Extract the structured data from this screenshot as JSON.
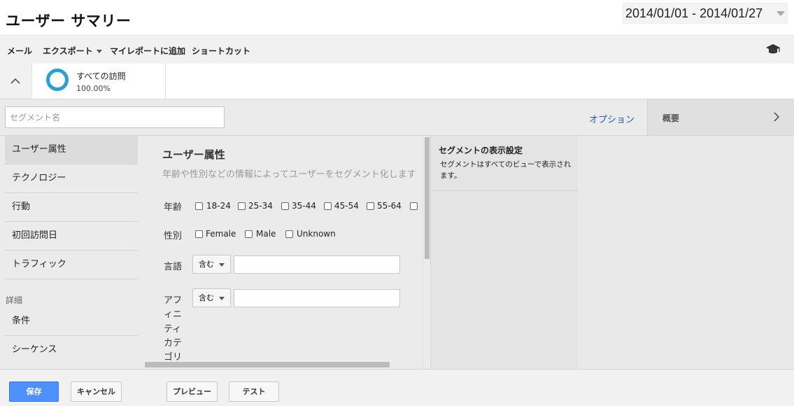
{
  "header": {
    "title": "ユーザー サマリー",
    "date_range": "2014/01/01 - 2014/01/27"
  },
  "toolbar": {
    "mail": "メール",
    "export": "エクスポート",
    "add_to_dashboard": "マイレポートに追加",
    "shortcut": "ショートカット"
  },
  "segment": {
    "name": "すべての訪問",
    "percent": "100.00%",
    "ring_color": "#2a9fd6"
  },
  "editor": {
    "name_placeholder": "セグメント名",
    "options_link": "オプション",
    "summary_label": "概要"
  },
  "nav": {
    "items": [
      "ユーザー属性",
      "テクノロジー",
      "行動",
      "初回訪問日",
      "トラフィック"
    ],
    "advanced_heading": "詳細",
    "advanced_items": [
      "条件",
      "シーケンス"
    ]
  },
  "form": {
    "title": "ユーザー属性",
    "description": "年齢や性別などの情報によってユーザーをセグメント化します",
    "age_label": "年齢",
    "age_options": [
      "18-24",
      "25-34",
      "35-44",
      "45-54",
      "55-64"
    ],
    "gender_label": "性別",
    "gender_options": [
      "Female",
      "Male",
      "Unknown"
    ],
    "language_label": "言語",
    "language_match": "含む",
    "affinity_label_chars": [
      "ア",
      "フ",
      "ィ",
      "ニ",
      "ティ",
      "カ",
      "テ",
      "ゴ",
      "リ"
    ],
    "affinity_label_lines": [
      "アフ",
      "ィニ",
      "ティ",
      "カテ",
      "ゴリ"
    ],
    "affinity_match": "含む"
  },
  "info": {
    "title": "セグメントの表示設定",
    "text": "セグメントはすべてのビューで表示されます。"
  },
  "buttons": {
    "save": "保存",
    "cancel": "キャンセル",
    "preview": "プレビュー",
    "test": "テスト"
  },
  "colors": {
    "primary_button": "#4d90fe",
    "link": "#1f5fa8"
  }
}
